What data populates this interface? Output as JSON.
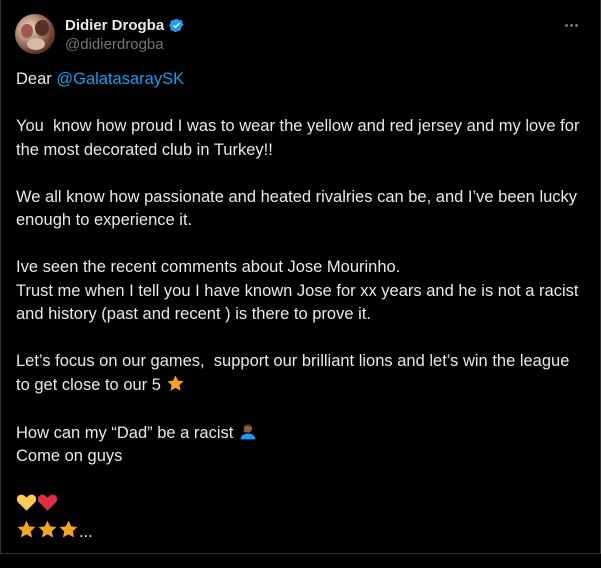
{
  "author": {
    "display_name": "Didier Drogba",
    "handle": "@didierdrogba",
    "verified_icon": "verified-badge-icon",
    "verified_color": "#1d9bf0"
  },
  "more_icon": "more-options-icon",
  "tweet": {
    "greeting_prefix": "Dear ",
    "mention": "@GalatasaraySK",
    "p1": "You  know how proud I was to wear the yellow and red jersey and my love for the most decorated club in Turkey!!",
    "p2": "We all know how passionate and heated rivalries can be, and I’ve been lucky enough to experience it.",
    "p3_line1": "Ive seen the recent comments about Jose Mourinho.",
    "p3_line2": "Trust me when I tell you I have known Jose for xx years and he is not a racist and history (past and recent ) is there to prove it.",
    "p4": "Let’s focus on our games,  support our brilliant lions and let’s win the league to get close to our 5 ",
    "p5_line1": "How can my “Dad” be a racist ",
    "p5_line2": "Come on guys",
    "ellipsis": "..."
  },
  "colors": {
    "background": "#000000",
    "text": "#e7e9ea",
    "muted": "#71767b",
    "link": "#1d9bf0"
  }
}
